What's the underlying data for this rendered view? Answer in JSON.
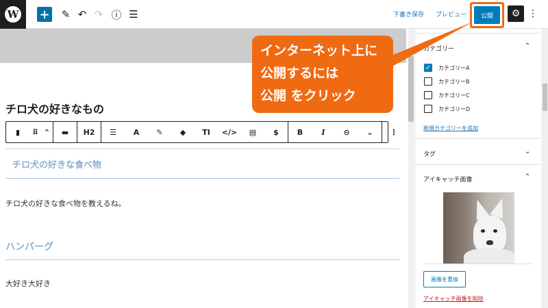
{
  "toolbar": {
    "wp_logo": "W",
    "add_icon": "+",
    "pen_icon": "✎",
    "undo_icon": "↶",
    "redo_icon": "↷",
    "info_icon": "ⓘ",
    "list_icon": "☰",
    "save_draft": "下書き保存",
    "preview": "プレビュー",
    "publish": "公開",
    "settings_icon": "⚙",
    "more_icon": "⋮"
  },
  "editor": {
    "title": "チロ犬の好きなもの",
    "block_toolbar": {
      "bookmark": "▮",
      "drag": "⠿",
      "move": "⌃",
      "align": "▬",
      "h2": "H2",
      "text_align": "☰",
      "font": "A",
      "highlight": "✎",
      "tag": "◆",
      "text_size": "TI",
      "code": "</>",
      "doc": "▤",
      "dollar": "$",
      "bold": "B",
      "italic": "I",
      "link": "⊝",
      "chevron": "⌄",
      "options": "⋮"
    },
    "heading1": "チロ犬の好きな食べ物",
    "para1": "チロ犬の好きな食べ物を教えるね。",
    "heading2": "ハンバーグ",
    "para2": "大好き大好き"
  },
  "sidebar": {
    "categories_heading": "カテゴリー",
    "categories": [
      {
        "label": "カテゴリーA",
        "checked": true
      },
      {
        "label": "カテゴリーB",
        "checked": false
      },
      {
        "label": "カテゴリーC",
        "checked": false
      },
      {
        "label": "カテゴリーD",
        "checked": false
      }
    ],
    "add_category": "新規カテゴリーを追加",
    "tags_heading": "タグ",
    "featured_heading": "アイキャッチ画像",
    "replace_image": "画像を置換",
    "remove_image": "アイキャッチ画像を削除",
    "chevron_up": "⌃",
    "chevron_down": "⌄",
    "check_mark": "✓"
  },
  "callout": {
    "line1": "インターネット上に",
    "line2": "公開するには",
    "line3": "公開 をクリック"
  },
  "colors": {
    "accent": "#007cba",
    "callout": "#f06a12",
    "heading_blue": "#8eafd6"
  }
}
